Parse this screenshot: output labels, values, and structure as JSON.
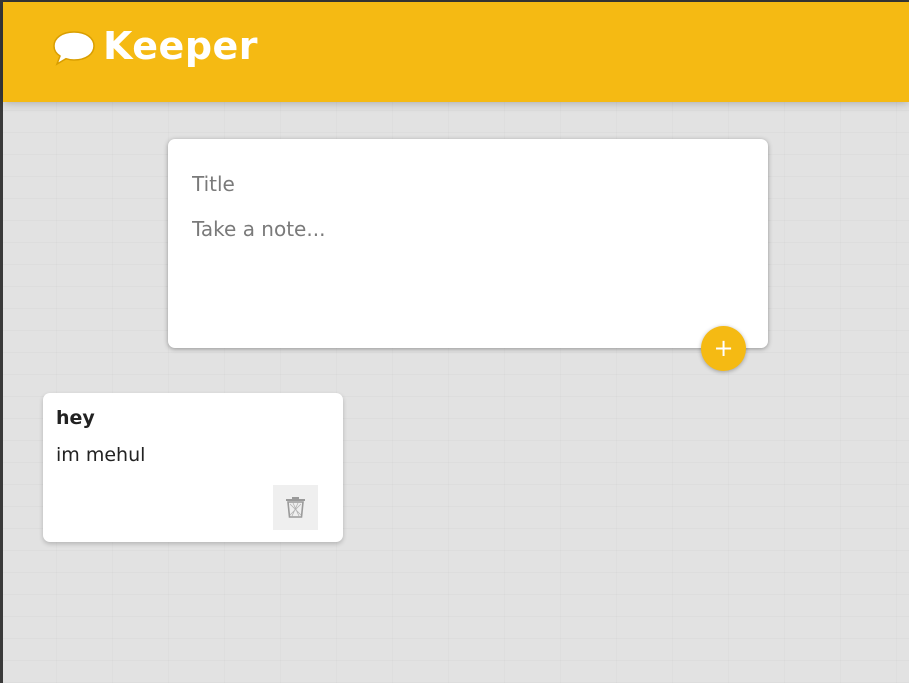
{
  "header": {
    "title": "Keeper",
    "logo_icon": "speech-bubble-icon",
    "accent_color": "#f5ba13"
  },
  "create_note": {
    "title_placeholder": "Title",
    "content_placeholder": "Take a note...",
    "add_button_label": "+"
  },
  "notes": [
    {
      "title": "hey",
      "content": "im mehul",
      "delete_icon": "trash-icon"
    }
  ]
}
